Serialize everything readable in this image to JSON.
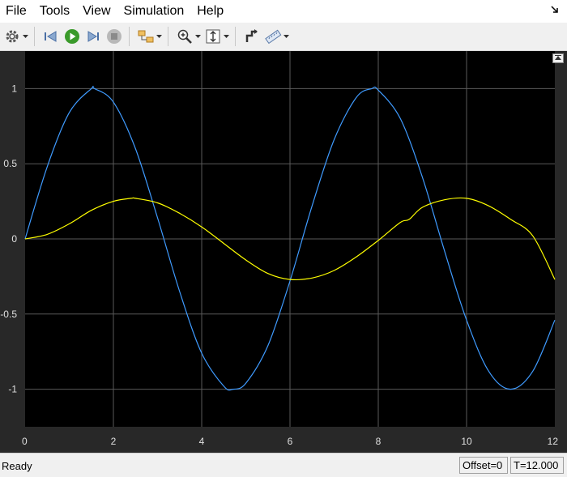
{
  "menu": {
    "items": [
      "File",
      "Tools",
      "View",
      "Simulation",
      "Help"
    ]
  },
  "toolbar": {
    "buttons": [
      {
        "icon": "gear-icon",
        "dropdown": true
      },
      {
        "icon": "step-back-icon",
        "dropdown": false
      },
      {
        "icon": "run-icon",
        "dropdown": false
      },
      {
        "icon": "step-forward-icon",
        "dropdown": false
      },
      {
        "icon": "stop-icon",
        "dropdown": false
      },
      {
        "icon": "layout-icon",
        "dropdown": true
      },
      {
        "icon": "zoom-in-icon",
        "dropdown": true
      },
      {
        "icon": "autoscale-icon",
        "dropdown": true
      },
      {
        "icon": "cursor-measure-icon",
        "dropdown": false
      },
      {
        "icon": "ruler-icon",
        "dropdown": true
      }
    ]
  },
  "colors": {
    "axes_background": "#000000",
    "figure_background": "#282828",
    "grid": "#5a5a5a",
    "series_1": "#3f9bff",
    "series_2": "#ffff00"
  },
  "chart_data": {
    "type": "line",
    "title": "",
    "xlabel": "",
    "ylabel": "",
    "xlim": [
      0,
      12
    ],
    "ylim": [
      -1.25,
      1.25
    ],
    "x_ticks": [
      0,
      2,
      4,
      6,
      8,
      10,
      12
    ],
    "y_ticks": [
      1,
      0.5,
      0,
      -0.5,
      -1
    ],
    "y_tick_labels": [
      "1",
      "0.5",
      "0",
      "-0.5",
      "-1"
    ],
    "grid": true,
    "series": [
      {
        "color": "#3f9bff",
        "x": [
          0,
          0.5,
          1,
          1.5,
          1.571,
          2,
          2.5,
          3,
          3.5,
          4,
          4.5,
          4.712,
          5,
          5.5,
          6,
          6.5,
          7,
          7.5,
          7.854,
          8,
          8.5,
          9,
          9.5,
          10,
          10.5,
          10.996,
          11.5,
          12
        ],
        "y": [
          0,
          0.48,
          0.84,
          1.0,
          1.0,
          0.91,
          0.6,
          0.14,
          -0.35,
          -0.76,
          -0.98,
          -1.0,
          -0.96,
          -0.71,
          -0.28,
          0.22,
          0.66,
          0.94,
          1.0,
          0.99,
          0.8,
          0.41,
          -0.08,
          -0.54,
          -0.88,
          -1.0,
          -0.88,
          -0.54
        ]
      },
      {
        "color": "#ffff00",
        "x": [
          0,
          0.5,
          1,
          1.5,
          2,
          2.4,
          2.5,
          3,
          3.5,
          4,
          4.5,
          5,
          5.5,
          6,
          6.5,
          7,
          7.5,
          8,
          8.5,
          8.7,
          9,
          9.5,
          10,
          10.5,
          11,
          11.5,
          12
        ],
        "y": [
          0,
          0.03,
          0.1,
          0.19,
          0.25,
          0.27,
          0.27,
          0.24,
          0.17,
          0.08,
          -0.03,
          -0.14,
          -0.23,
          -0.27,
          -0.26,
          -0.21,
          -0.12,
          -0.01,
          0.11,
          0.13,
          0.21,
          0.26,
          0.27,
          0.22,
          0.13,
          0.02,
          -0.27
        ]
      }
    ]
  },
  "status": {
    "state": "Ready",
    "offset": "Offset=0",
    "time": "T=12.000"
  }
}
